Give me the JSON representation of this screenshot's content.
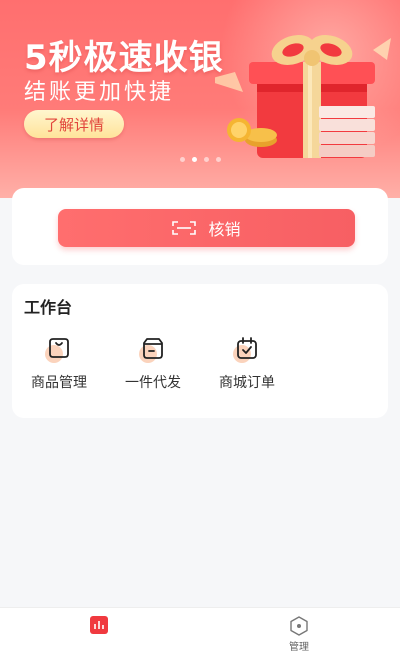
{
  "banner": {
    "title": "5秒极速收银",
    "subtitle": "结账更加快捷",
    "detail_button": "了解详情",
    "carousel": {
      "count": 4,
      "active_index": 1
    }
  },
  "verify": {
    "label": "核销"
  },
  "workbench": {
    "title": "工作台",
    "items": [
      {
        "label": "商品管理",
        "icon": "product-bag-icon"
      },
      {
        "label": "一件代发",
        "icon": "dropship-box-icon"
      },
      {
        "label": "商城订单",
        "icon": "calendar-check-icon"
      }
    ]
  },
  "bottom_nav": {
    "items": [
      {
        "label": "",
        "icon": "dashboard-chart-icon",
        "active": true
      },
      {
        "label": "管理",
        "icon": "hexagon-settings-icon",
        "active": false
      }
    ]
  },
  "colors": {
    "accent": "#f75f63",
    "banner_top": "#ff6f6f",
    "button_gold": "#ffe39a",
    "icon_blob": "#fbd3bc"
  }
}
